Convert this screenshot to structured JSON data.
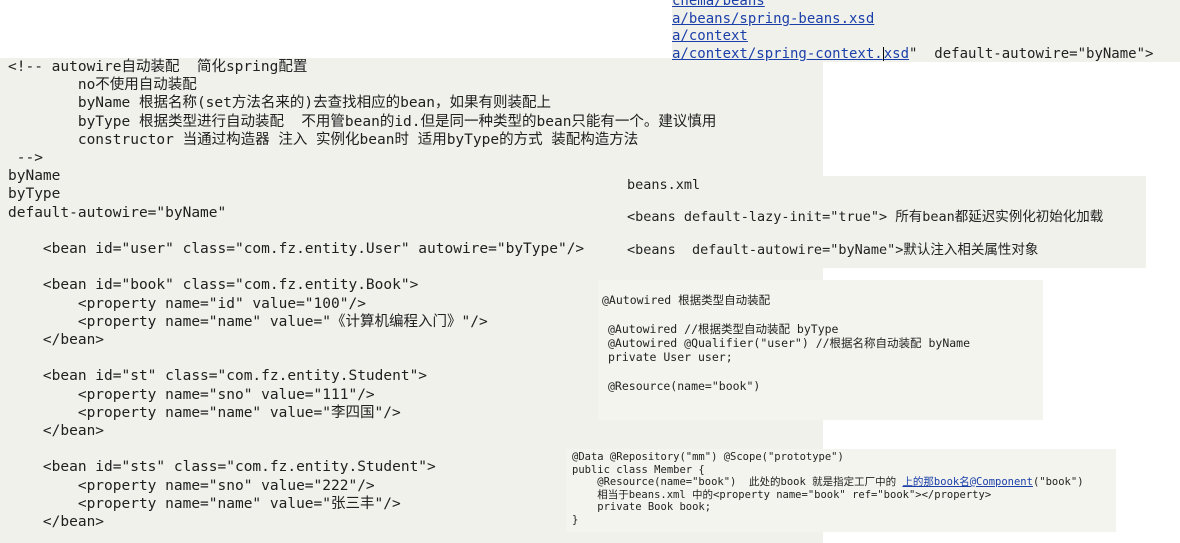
{
  "xml_header": {
    "line1": "chema/beans",
    "line2": "a/beans/spring-beans.xsd",
    "line3": "a/context",
    "line4_link_a": "a/context/spring-context.",
    "line4_link_b": "xsd",
    "line4_rest": "\"  default-autowire=\"byName\">"
  },
  "main_code": {
    "lines": [
      "<!-- autowire自动装配  简化spring配置",
      "        no不使用自动装配",
      "        byName 根据名称(set方法名来的)去查找相应的bean，如果有则装配上",
      "        byType 根据类型进行自动装配  不用管bean的id.但是同一种类型的bean只能有一个。建议慎用",
      "        constructor 当通过构造器 注入 实例化bean时 适用byType的方式 装配构造方法",
      " -->",
      "byName",
      "byType",
      "default-autowire=\"byName\"",
      "",
      "    <bean id=\"user\" class=\"com.fz.entity.User\" autowire=\"byType\"/>",
      "",
      "    <bean id=\"book\" class=\"com.fz.entity.Book\">",
      "        <property name=\"id\" value=\"100\"/>",
      "        <property name=\"name\" value=\"《计算机编程入门》\"/>",
      "    </bean>",
      "",
      "    <bean id=\"st\" class=\"com.fz.entity.Student\">",
      "        <property name=\"sno\" value=\"111\"/>",
      "        <property name=\"name\" value=\"李四国\"/>",
      "    </bean>",
      "",
      "    <bean id=\"sts\" class=\"com.fz.entity.Student\">",
      "        <property name=\"sno\" value=\"222\"/>",
      "        <property name=\"name\" value=\"张三丰\"/>",
      "    </bean>"
    ]
  },
  "beans_note": {
    "line1": "beans.xml",
    "line2": "<beans default-lazy-init=\"true\"> 所有bean都延迟实例化初始化加载",
    "line3": "<beans  default-autowire=\"byName\">默认注入相关属性对象"
  },
  "autowired": {
    "title": "@Autowired 根据类型自动装配",
    "line1": "@Autowired //根据类型自动装配 byType",
    "line2": "@Autowired @Qualifier(\"user\") //根据名称自动装配 byName",
    "line3": "private User user;",
    "line4": "@Resource(name=\"book\")"
  },
  "member": {
    "line1": "@Data @Repository(\"mm\") @Scope(\"prototype\")",
    "line2": "public class Member {",
    "line3_code": "    @Resource(name=\"book\")  此处的book 就是指定工厂中的 ",
    "line3_link": "上的那book名@Component",
    "line3_tail": "(\"book\")",
    "line4": "    相当于beans.xml 中的<property name=\"book\" ref=\"book\"></property>",
    "line5": "    private Book book;",
    "line6": "}"
  }
}
